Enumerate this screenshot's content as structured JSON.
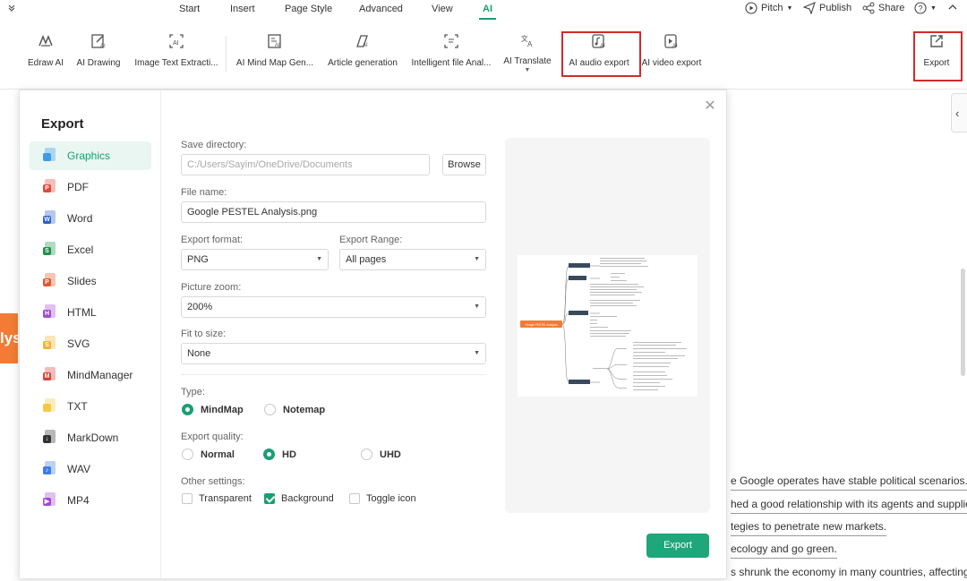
{
  "menu": {
    "tabs": [
      "Start",
      "Insert",
      "Page Style",
      "Advanced",
      "View",
      "AI"
    ],
    "active_tab": "AI",
    "pitch": "Pitch",
    "publish": "Publish",
    "share": "Share"
  },
  "ribbon": {
    "tools": [
      {
        "label": "Edraw AI",
        "icon": "edraw-ai-icon"
      },
      {
        "label": "AI Drawing",
        "icon": "ai-drawing-icon"
      },
      {
        "label": "Image Text Extracti...",
        "icon": "image-text-extract-icon"
      },
      {
        "label": "AI Mind Map Gen...",
        "icon": "ai-mindmap-icon"
      },
      {
        "label": "Article generation",
        "icon": "article-generation-icon"
      },
      {
        "label": "Intelligent file Anal...",
        "icon": "file-analysis-icon"
      },
      {
        "label": "AI Translate",
        "icon": "translate-icon"
      },
      {
        "label": "AI audio export",
        "icon": "audio-export-icon"
      },
      {
        "label": "AI video export",
        "icon": "video-export-icon"
      }
    ],
    "export_label": "Export",
    "highlight_color": "#d32a2a"
  },
  "background": {
    "tag_text": "lys",
    "lines": [
      "e Google operates have stable political scenarios.",
      "hed a good relationship with its agents and suppliers",
      "tegies to penetrate new markets.",
      "ecology and go green.",
      "s shrunk the economy in many countries, affecting"
    ]
  },
  "dialog": {
    "title": "Export",
    "formats": [
      {
        "label": "Graphics",
        "color": "#3d9be9",
        "mark": ""
      },
      {
        "label": "PDF",
        "color": "#e0473b",
        "mark": "P"
      },
      {
        "label": "Word",
        "color": "#2b5fc9",
        "mark": "W"
      },
      {
        "label": "Excel",
        "color": "#1f8f4c",
        "mark": "S"
      },
      {
        "label": "Slides",
        "color": "#e2582f",
        "mark": "P"
      },
      {
        "label": "HTML",
        "color": "#a24bd1",
        "mark": "H"
      },
      {
        "label": "SVG",
        "color": "#f2b233",
        "mark": "S"
      },
      {
        "label": "MindManager",
        "color": "#d9403a",
        "mark": "M"
      },
      {
        "label": "TXT",
        "color": "#f5c842",
        "mark": "TXT"
      },
      {
        "label": "MarkDown",
        "color": "#333333",
        "mark": "↓"
      },
      {
        "label": "WAV",
        "color": "#3d7be9",
        "mark": "♪"
      },
      {
        "label": "MP4",
        "color": "#a24bd1",
        "mark": "▶"
      }
    ],
    "active_format": "Graphics",
    "save_directory_label": "Save directory:",
    "save_directory_placeholder": "C:/Users/Sayim/OneDrive/Documents",
    "browse_label": "Browse",
    "file_name_label": "File name:",
    "file_name_value": "Google PESTEL Analysis.png",
    "export_format_label": "Export format:",
    "export_format_value": "PNG",
    "export_range_label": "Export Range:",
    "export_range_value": "All pages",
    "picture_zoom_label": "Picture zoom:",
    "picture_zoom_value": "200%",
    "fit_to_size_label": "Fit to size:",
    "fit_to_size_value": "None",
    "type_label": "Type:",
    "type_options": [
      "MindMap",
      "Notemap"
    ],
    "type_selected": "MindMap",
    "quality_label": "Export quality:",
    "quality_options": [
      "Normal",
      "HD",
      "UHD"
    ],
    "quality_selected": "HD",
    "other_label": "Other settings:",
    "other_options": [
      {
        "label": "Transparent",
        "checked": false
      },
      {
        "label": "Background",
        "checked": true
      },
      {
        "label": "Toggle icon",
        "checked": false
      }
    ],
    "export_button": "Export",
    "preview_root_label": "Google PESTEL Analysis",
    "accent_color": "#1a9e74"
  }
}
